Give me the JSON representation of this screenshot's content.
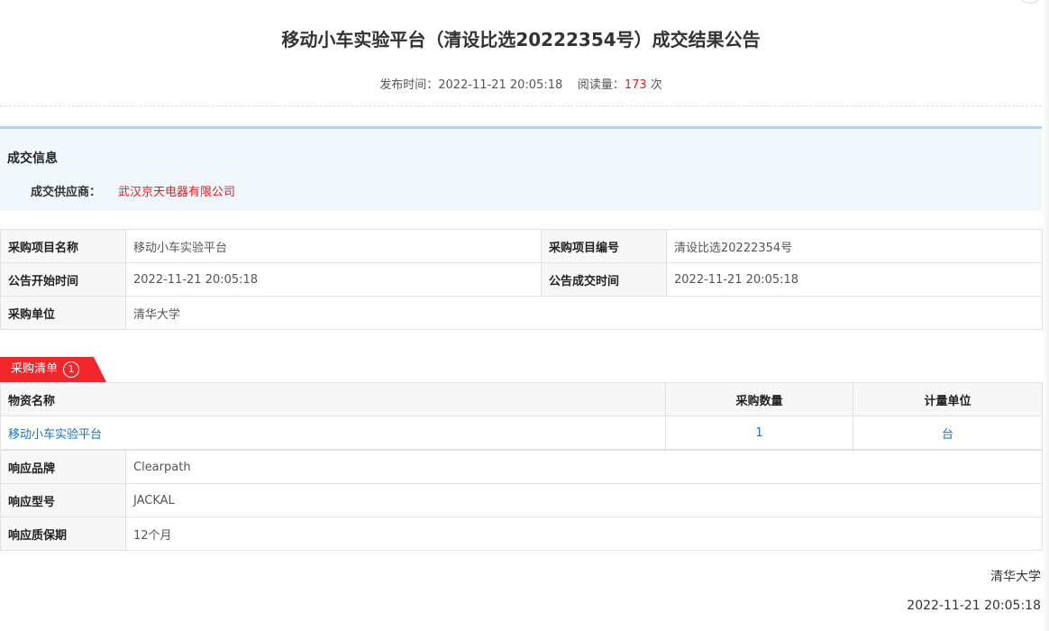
{
  "header": {
    "title": "移动小车实验平台（清设比选20222354号）成交结果公告",
    "publish_label": "发布时间：",
    "publish_time": "2022-11-21 20:05:18",
    "read_label": "阅读量：",
    "read_count": "173",
    "read_unit": "次"
  },
  "deal_info": {
    "title": "成交信息",
    "supplier_label": "成交供应商：",
    "supplier_value": "武汉京天电器有限公司"
  },
  "project": {
    "name_label": "采购项目名称",
    "name_value": "移动小车实验平台",
    "code_label": "采购项目编号",
    "code_value": "清设比选20222354号",
    "start_label": "公告开始时间",
    "start_value": "2022-11-21 20:05:18",
    "deal_time_label": "公告成交时间",
    "deal_time_value": "2022-11-21 20:05:18",
    "unit_label": "采购单位",
    "unit_value": "清华大学"
  },
  "purchase_list": {
    "tab_label": "采购清单",
    "tab_count": "1",
    "headers": [
      "物资名称",
      "采购数量",
      "计量单位"
    ],
    "rows": [
      {
        "name": "移动小车实验平台",
        "qty": "1",
        "unit": "台"
      }
    ]
  },
  "response": {
    "brand_label": "响应品牌",
    "brand_value": "Clearpath",
    "model_label": "响应型号",
    "model_value": "JACKAL",
    "warranty_label": "响应质保期",
    "warranty_value": "12个月"
  },
  "footer": {
    "org": "清华大学",
    "date": "2022-11-21 20:05:18"
  },
  "colors": {
    "accent_red": "#e21a1a",
    "tab_red": "#f0262b",
    "link_blue": "#1570c9",
    "info_bg": "#f1f8fc"
  }
}
